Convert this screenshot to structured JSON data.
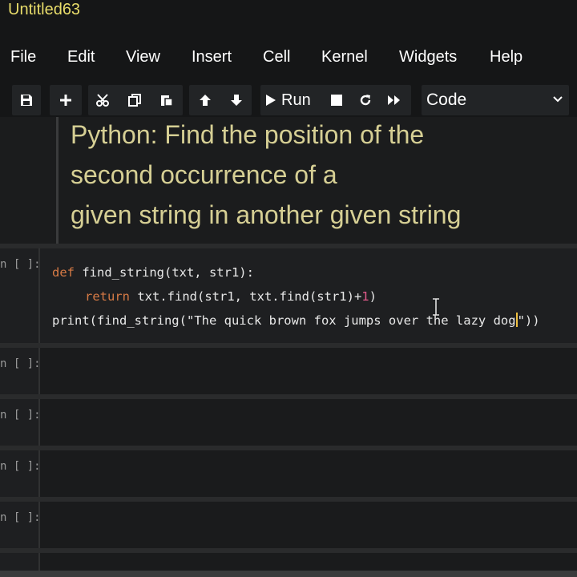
{
  "notebook": {
    "title": "Untitled63"
  },
  "menu": [
    "File",
    "Edit",
    "View",
    "Insert",
    "Cell",
    "Kernel",
    "Widgets",
    "Help"
  ],
  "toolbar": {
    "run_label": "Run",
    "cell_type": "Code",
    "icons": [
      "save-icon",
      "plus-icon",
      "cut-icon",
      "copy-icon",
      "paste-icon",
      "arrow-up-icon",
      "arrow-down-icon",
      "play-icon",
      "stop-icon",
      "restart-icon",
      "fast-forward-icon"
    ]
  },
  "markdown": {
    "lines": [
      "Python: Find the position of the",
      "second occurrence of a",
      "given string in another given string"
    ]
  },
  "code_cell": {
    "prompt": "n [ ]:",
    "line1_kw": "def",
    "line1_rest": " find_string(txt, str1):",
    "line2_kw": "return",
    "line2_a": " txt.find(str1, txt.find(str1)+",
    "line2_num": "1",
    "line2_b": ")",
    "line3_a": "print(find_string(\"The quick brown fox jumps over the lazy dog",
    "line3_b": "\"))"
  },
  "empty_cells": [
    {
      "prompt": "n [ ]:"
    },
    {
      "prompt": "n [ ]:"
    },
    {
      "prompt": "n [ ]:"
    },
    {
      "prompt": "n [ ]:"
    }
  ],
  "colors": {
    "title": "#e8dc6a",
    "markdown_text": "#d6cf94",
    "keyword": "#d67a45",
    "number": "#e05a8a"
  }
}
